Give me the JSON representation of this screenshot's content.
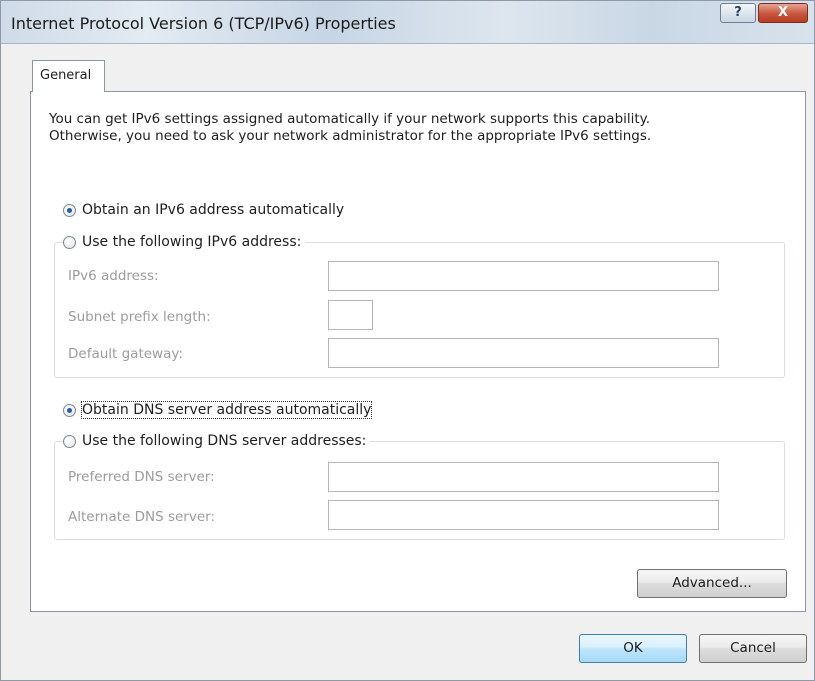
{
  "window": {
    "title": "Internet Protocol Version 6 (TCP/IPv6) Properties",
    "help_glyph": "?",
    "close_glyph": "X"
  },
  "tabs": [
    {
      "label": "General",
      "selected": true
    }
  ],
  "intro": {
    "line1": "You can get IPv6 settings assigned automatically if your network supports this capability.",
    "line2": "Otherwise, you need to ask your network administrator for the appropriate IPv6 settings."
  },
  "ip_section": {
    "auto_label": "Obtain an IPv6 address automatically",
    "auto_checked": true,
    "manual_label": "Use the following IPv6 address:",
    "manual_checked": false,
    "fields": {
      "address": {
        "label": "IPv6 address:",
        "value": ""
      },
      "prefix": {
        "label": "Subnet prefix length:",
        "value": ""
      },
      "gateway": {
        "label": "Default gateway:",
        "value": ""
      }
    }
  },
  "dns_section": {
    "auto_label": "Obtain DNS server address automatically",
    "auto_checked": true,
    "manual_label": "Use the following DNS server addresses:",
    "manual_checked": false,
    "fields": {
      "preferred": {
        "label": "Preferred DNS server:",
        "value": ""
      },
      "alternate": {
        "label": "Alternate DNS server:",
        "value": ""
      }
    }
  },
  "buttons": {
    "advanced": "Advanced...",
    "ok": "OK",
    "cancel": "Cancel"
  },
  "colors": {
    "disabled_text": "#9c9c9c",
    "default_button_border": "#3c7fb1",
    "close_button": "#c7553c"
  }
}
